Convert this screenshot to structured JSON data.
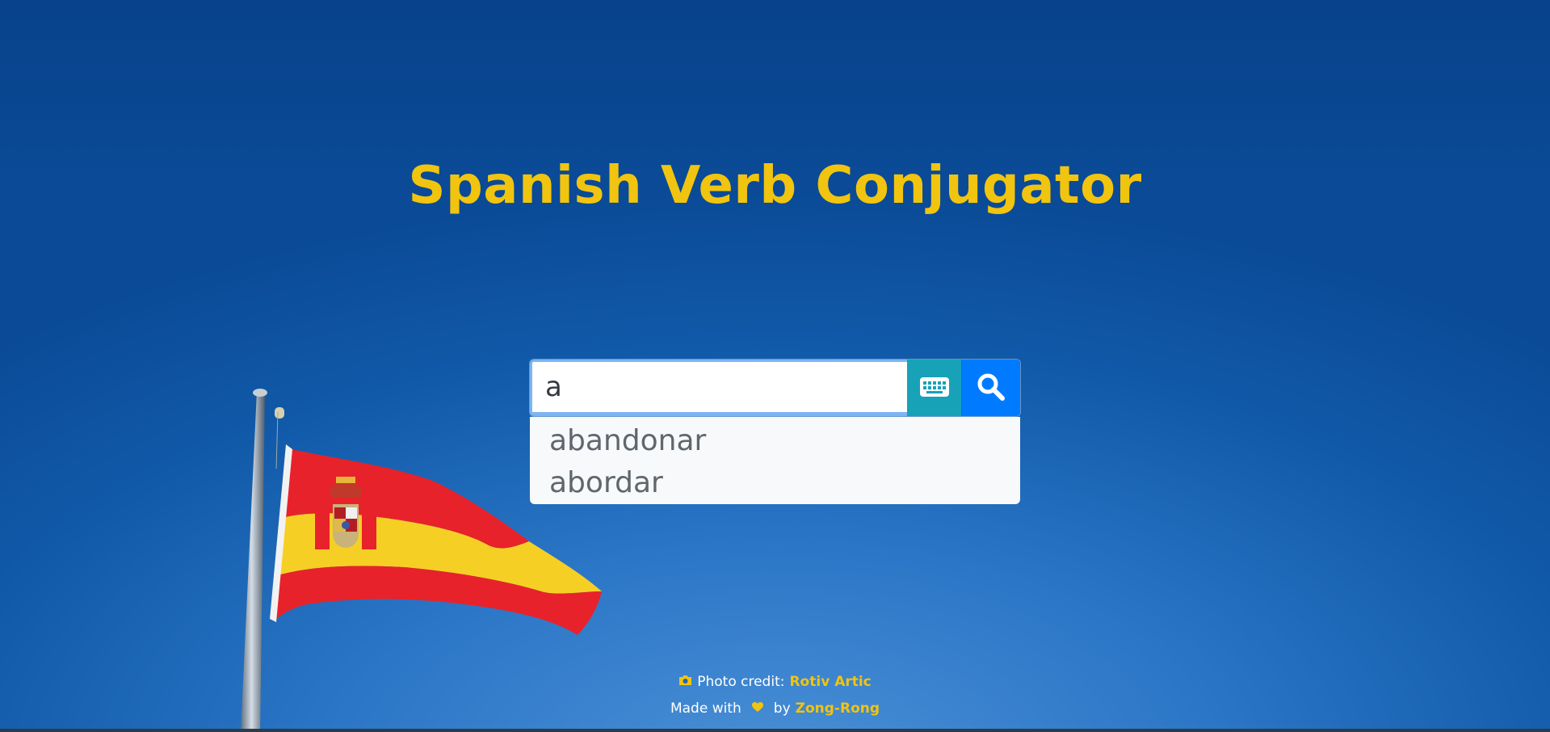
{
  "page": {
    "title": "Spanish Verb Conjugator"
  },
  "search": {
    "value": "a",
    "keyboard_icon": "keyboard-icon",
    "search_icon": "search-icon",
    "suggestions": [
      "abandonar",
      "abordar"
    ]
  },
  "footer": {
    "photo_icon": "camera-icon",
    "photo_credit_label": "Photo credit:",
    "photo_credit_name": "Rotiv Artic",
    "made_with_label": "Made with",
    "heart_icon": "heart-icon",
    "by_label": "by",
    "author_name": "Zong-Rong"
  },
  "colors": {
    "title": "#f1c40f",
    "keyboard_button": "#17a2b8",
    "search_button": "#007bff",
    "link": "#f1c40f"
  }
}
